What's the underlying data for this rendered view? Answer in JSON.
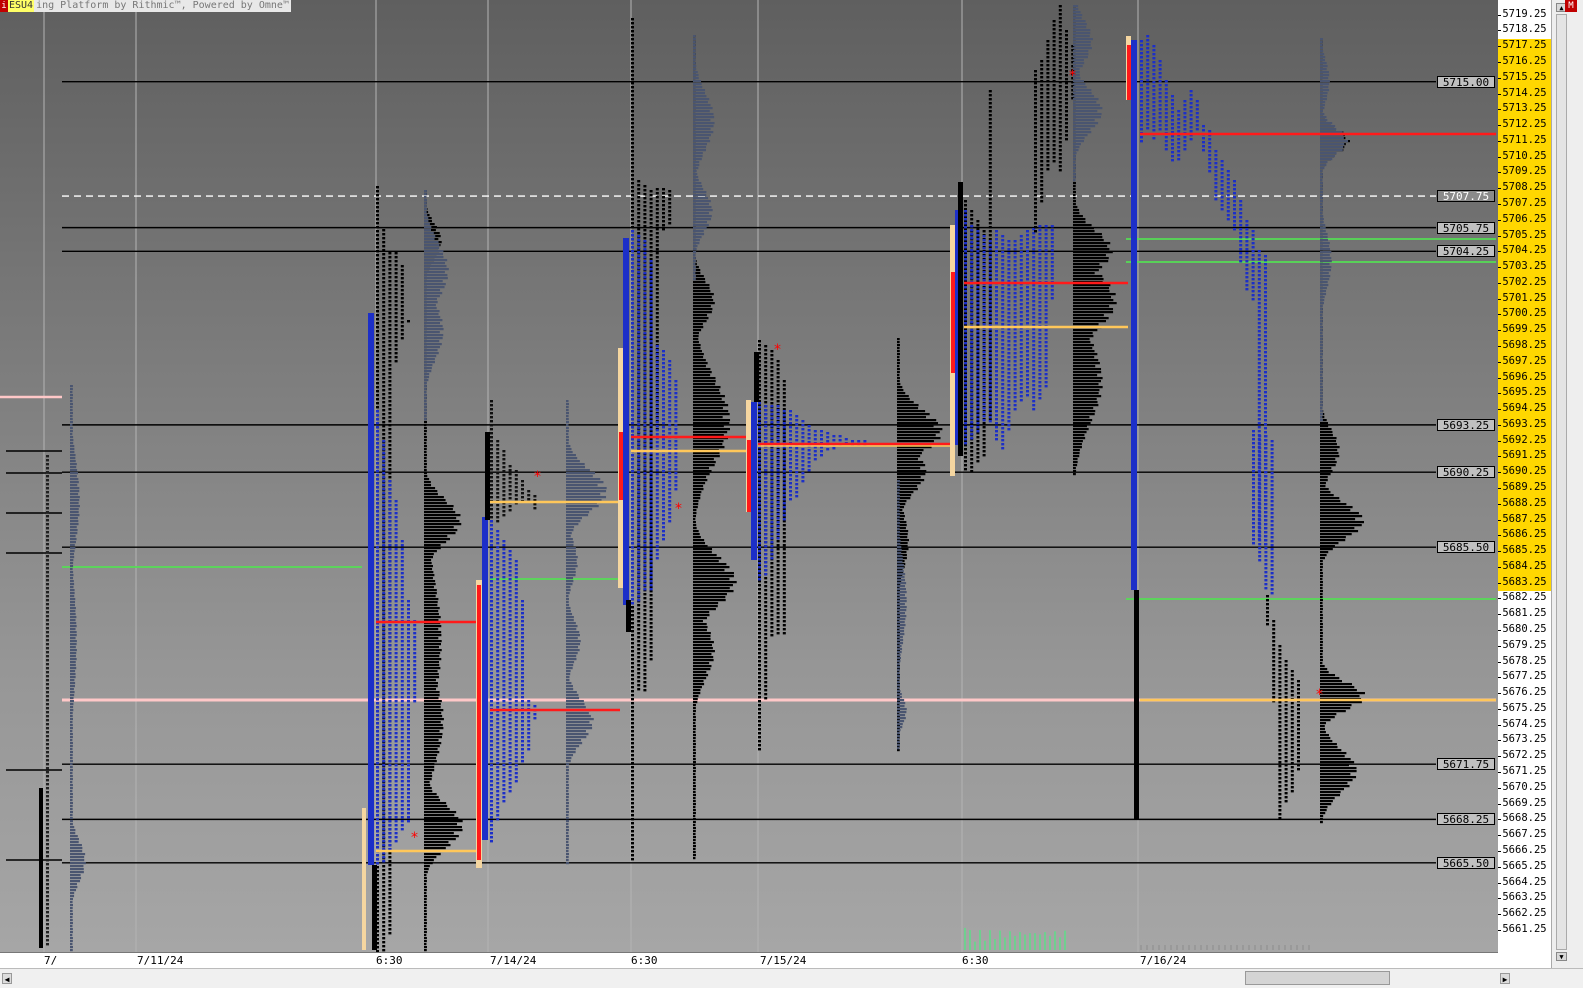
{
  "app": {
    "info_badge": "i",
    "symbol": "ESU4",
    "caption": "ing Platform by Rithmic™, Powered by Omne™",
    "corner_button": "M"
  },
  "price_axis": {
    "labels": [
      "5719.25",
      "5718.25",
      "5717.25",
      "5716.25",
      "5715.25",
      "5714.25",
      "5713.25",
      "5712.25",
      "5711.25",
      "5710.25",
      "5709.25",
      "5708.25",
      "5707.25",
      "5706.25",
      "5705.25",
      "5704.25",
      "5703.25",
      "5702.25",
      "5701.25",
      "5700.25",
      "5699.25",
      "5698.25",
      "5697.25",
      "5696.25",
      "5695.25",
      "5694.25",
      "5693.25",
      "5692.25",
      "5691.25",
      "5690.25",
      "5689.25",
      "5688.25",
      "5687.25",
      "5686.25",
      "5685.25",
      "5684.25",
      "5683.25",
      "5682.25",
      "5681.25",
      "5680.25",
      "5679.25",
      "5678.25",
      "5677.25",
      "5676.25",
      "5675.25",
      "5674.25",
      "5673.25",
      "5672.25",
      "5671.25",
      "5670.25",
      "5669.25",
      "5668.25",
      "5667.25",
      "5666.25",
      "5665.25",
      "5664.25",
      "5663.25",
      "5662.25",
      "5661.25"
    ],
    "highlighted_from": "5717.25",
    "highlighted_to": "5683.25",
    "highlight_color": "#ffd700"
  },
  "reference_levels": [
    {
      "label": "5715.00",
      "price": 5715.0,
      "style": "solid"
    },
    {
      "label": "5707.75",
      "price": 5707.75,
      "style": "dashed"
    },
    {
      "label": "5705.75",
      "price": 5705.75,
      "style": "solid"
    },
    {
      "label": "5704.25",
      "price": 5704.25,
      "style": "solid"
    },
    {
      "label": "5693.25",
      "price": 5693.25,
      "style": "solid"
    },
    {
      "label": "5690.25",
      "price": 5690.25,
      "style": "solid"
    },
    {
      "label": "5685.50",
      "price": 5685.5,
      "style": "solid"
    },
    {
      "label": "5671.75",
      "price": 5671.75,
      "style": "solid"
    },
    {
      "label": "5668.25",
      "price": 5668.25,
      "style": "solid"
    },
    {
      "label": "5665.50",
      "price": 5665.5,
      "style": "solid"
    }
  ],
  "date_axis": [
    "7/",
    "7/11/24",
    "6:30",
    "7/14/24",
    "6:30",
    "7/15/24",
    "6:30",
    "7/16/24"
  ],
  "colors": {
    "tpo_blue": "#1c2fc8",
    "tpo_black": "#000000",
    "profile_slate": "#4a5570",
    "poc_red": "#ff1a1a",
    "vwap_orange": "#ffc75a",
    "green_level": "#55dd55",
    "pink_level": "#ffc8c8",
    "marker_star": "#ff0000"
  }
}
